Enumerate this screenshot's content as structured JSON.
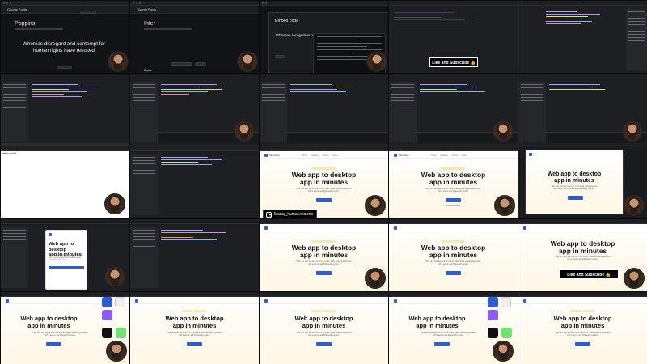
{
  "tiles": {
    "poppins": {
      "font_name": "Poppins",
      "sample_text": "Whereas disregard and contempt for human rights have resulted",
      "site": "Google Fonts"
    },
    "inter": {
      "font_name": "Inter",
      "site": "Google Fonts",
      "footer_label": "Styles"
    },
    "embed": {
      "dialog_title": "Embed code",
      "sample_text": "Whereas recognition o",
      "site": "Google Fonts"
    },
    "blank_doc": {
      "text": "hello world"
    },
    "landing": {
      "brand": "Tauri App",
      "nav_links": "Home Features Pricing Docs",
      "headline_line1": "Web app to desktop",
      "headline_line2": "app in minutes",
      "description": "Take your web app and turn it into a fast, native desktop application with a secure and lightweight runtime."
    },
    "overlays": {
      "like_subscribe": "Like and Subscribe 👍",
      "instagram_handle": "Manuj_kumar.sharma"
    }
  }
}
